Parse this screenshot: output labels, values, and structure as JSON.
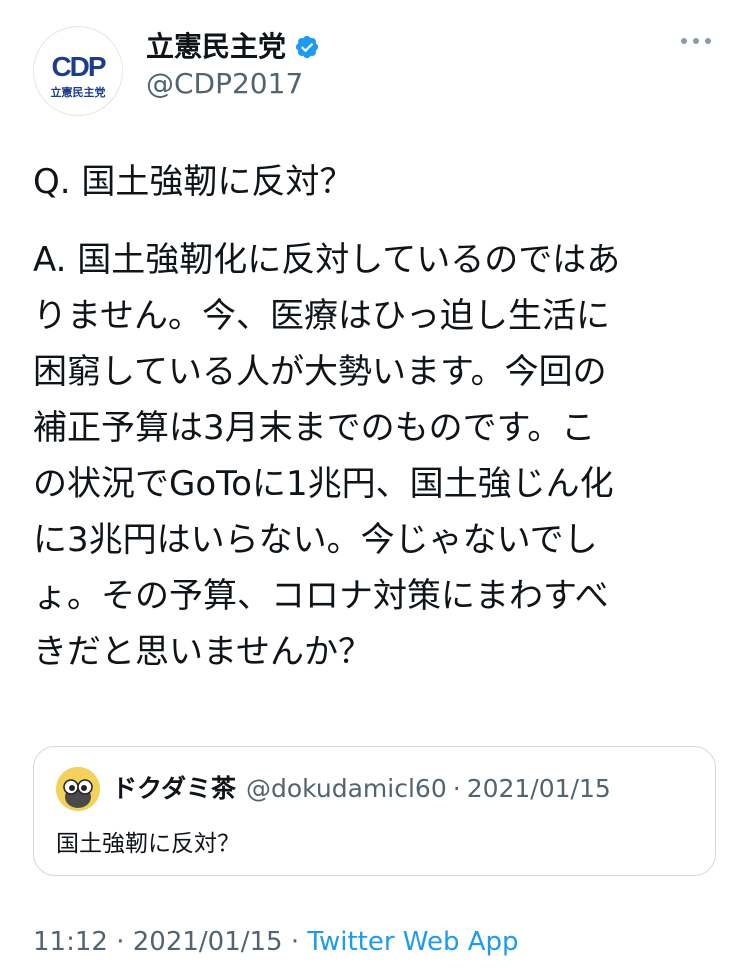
{
  "author": {
    "name": "立憲民主党",
    "handle": "@CDP2017",
    "avatar_logo_text": "CDP",
    "avatar_caption": "立憲民主党",
    "verified_icon": "verified-badge-icon"
  },
  "tweet": {
    "question": "Q. 国土強靭に反対？",
    "answer": "A. 国土強靭化に反対しているのではあ\nりません。今、医療はひっ迫し生活に\n困窮している人が大勢います。今回の\n補正予算は3月末までのものです。こ\nの状況でGoToに1兆円、国土強じん化\nに3兆円はいらない。今じゃないでし\nょ。その予算、コロナ対策にまわすべ\nきだと思いませんか？"
  },
  "quoted_tweet": {
    "name": "ドクダミ茶",
    "handle": "@dokudamicl60",
    "separator": "·",
    "date": "2021/01/15",
    "text": "国土強靭に反対？"
  },
  "footer": {
    "time": "11:12",
    "separator1": " · ",
    "date": "2021/01/15",
    "separator2": " · ",
    "source": "Twitter Web App"
  },
  "colors": {
    "verified": "#1d9bf0",
    "link": "#1d9bf0",
    "secondary_text": "#536471",
    "logo_blue": "#1d3c8c"
  }
}
